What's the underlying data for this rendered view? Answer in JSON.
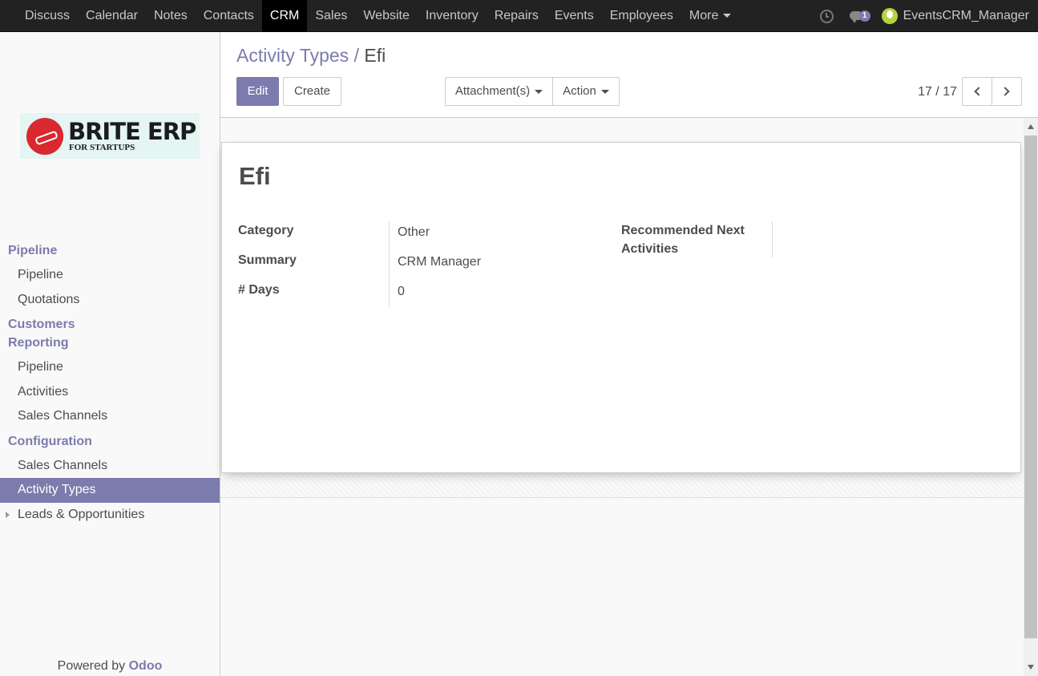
{
  "topbar": {
    "apps": [
      "Discuss",
      "Calendar",
      "Notes",
      "Contacts",
      "CRM",
      "Sales",
      "Website",
      "Inventory",
      "Repairs",
      "Events",
      "Employees"
    ],
    "active_app": "CRM",
    "more_label": "More",
    "chat_badge": "1",
    "username": "EventsCRM_Manager"
  },
  "logo": {
    "main": "BRITE ERP",
    "sub": "FOR STARTUPS"
  },
  "sidebar": {
    "sections": [
      {
        "title": "Pipeline",
        "items": [
          "Pipeline",
          "Quotations"
        ]
      },
      {
        "title": "Customers",
        "items": []
      },
      {
        "title": "Reporting",
        "items": [
          "Pipeline",
          "Activities",
          "Sales Channels"
        ]
      },
      {
        "title": "Configuration",
        "items": [
          "Sales Channels",
          "Activity Types",
          "Leads & Opportunities"
        ]
      }
    ],
    "active_item": "Activity Types",
    "powered_prefix": "Powered by",
    "powered_brand": "Odoo"
  },
  "breadcrumb": {
    "parent": "Activity Types",
    "separator": "/",
    "current": "Efi"
  },
  "buttons": {
    "edit": "Edit",
    "create": "Create",
    "attachments": "Attachment(s)",
    "action": "Action"
  },
  "pager": {
    "value": "17 / 17"
  },
  "record": {
    "title": "Efi",
    "labels": {
      "category": "Category",
      "summary": "Summary",
      "days": "# Days",
      "recommended": "Recommended Next Activities"
    },
    "values": {
      "category": "Other",
      "summary": "CRM Manager",
      "days": "0"
    }
  },
  "colors": {
    "accent": "#7c7bad",
    "topbar": "#222222"
  }
}
